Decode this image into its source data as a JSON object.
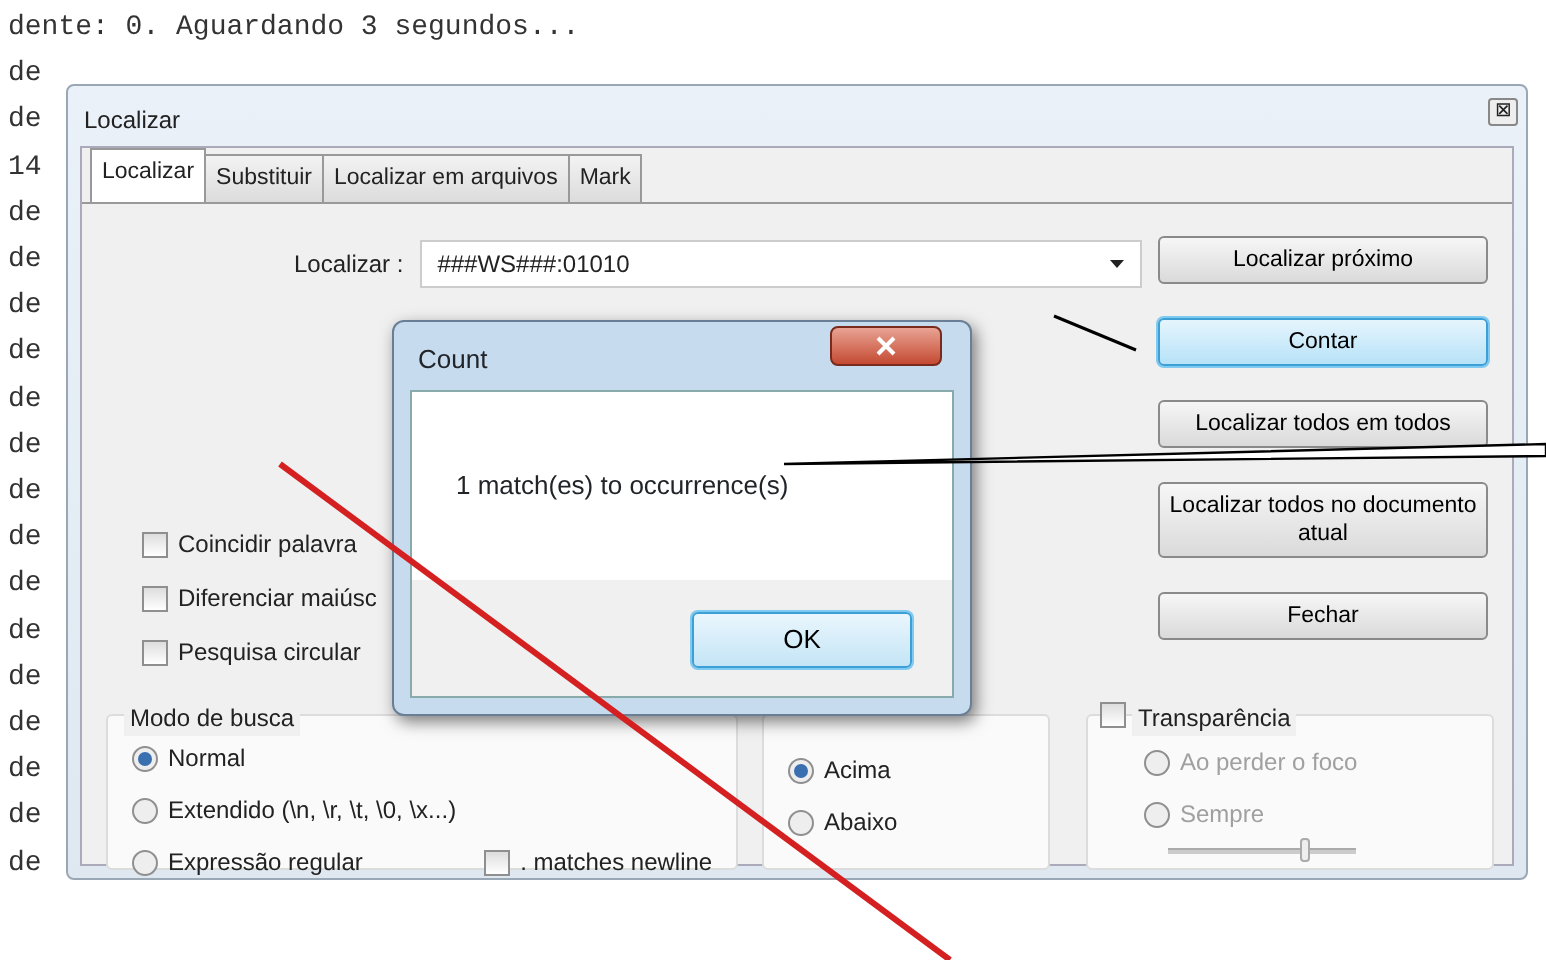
{
  "editor": {
    "lines": [
      "dente: 0. Aguardando 3 segundos...",
      "de",
      "de",
      "14",
      "de",
      "de",
      "de",
      "de",
      "de",
      "de",
      "de",
      "de",
      "de",
      "de",
      "de",
      "de",
      "de",
      "de",
      "de"
    ]
  },
  "find_dialog": {
    "title": "Localizar",
    "close_icon": "⊠",
    "tabs": [
      {
        "label": "Localizar",
        "selected": true
      },
      {
        "label": "Substituir",
        "selected": false
      },
      {
        "label": "Localizar em arquivos",
        "selected": false
      },
      {
        "label": "Mark",
        "selected": false
      }
    ],
    "find_label": "Localizar :",
    "find_value": "###WS###:01010",
    "buttons": [
      {
        "label": "Localizar próximo",
        "focused": false
      },
      {
        "label": "Contar",
        "focused": true
      },
      {
        "label": "Localizar todos em todos",
        "focused": false
      },
      {
        "label": "Localizar todos no documento atual",
        "focused": false
      },
      {
        "label": "Fechar",
        "focused": false
      }
    ],
    "options": [
      {
        "label": "Coincidir palavra",
        "checked": false
      },
      {
        "label": "Diferenciar maiúsc",
        "checked": false
      },
      {
        "label": "Pesquisa circular",
        "checked": false
      }
    ],
    "search_mode": {
      "title": "Modo de busca",
      "options": [
        {
          "label": "Normal",
          "selected": true
        },
        {
          "label": "Extendido  (\\n, \\r, \\t, \\0, \\x...)",
          "selected": false
        },
        {
          "label": "Expressão regular",
          "selected": false
        }
      ],
      "dot_newline": {
        "label": ". matches newline",
        "checked": false
      }
    },
    "direction": {
      "options": [
        {
          "label": "Acima",
          "selected": true
        },
        {
          "label": "Abaixo",
          "selected": false
        }
      ]
    },
    "transparency": {
      "label": "Transparência",
      "checked": false,
      "options": [
        {
          "label": "Ao perder o foco",
          "selected": false
        },
        {
          "label": "Sempre",
          "selected": false
        }
      ],
      "level": 0.73
    }
  },
  "count_dialog": {
    "title": "Count",
    "message": "1 match(es) to occurrence(s)",
    "ok": "OK"
  }
}
